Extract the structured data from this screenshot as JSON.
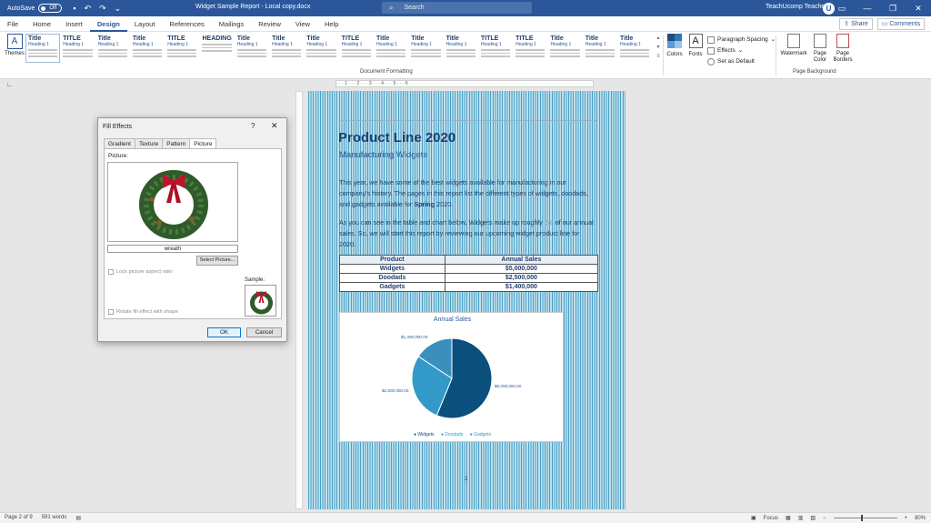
{
  "titlebar": {
    "autosave_label": "AutoSave",
    "autosave_state": "Off",
    "doc_title": "Widget Sample Report - Local copy.docx",
    "search_placeholder": "Search",
    "user_name": "TeachUcomp Teacher",
    "avatar_initial": "U"
  },
  "tabs": [
    "File",
    "Home",
    "Insert",
    "Design",
    "Layout",
    "References",
    "Mailings",
    "Review",
    "View",
    "Help"
  ],
  "active_tab": "Design",
  "share_label": "Share",
  "comments_label": "Comments",
  "ribbon": {
    "themes_label": "Themes",
    "style_titles": [
      "Title",
      "TITLE",
      "Title",
      "Title",
      "TITLE",
      "HEADING 1",
      "Title",
      "Title",
      "Title",
      "TITLE",
      "Title",
      "Title",
      "Title",
      "TITLE",
      "TITLE",
      "Title",
      "Title",
      "Title"
    ],
    "style_headings": [
      "Heading 1",
      "Heading 1",
      "Heading 1",
      "Heading 1",
      "Heading 1",
      "",
      "Heading 1",
      "Heading 1",
      "Heading 1",
      "Heading 1",
      "Heading 1",
      "Heading 1",
      "Heading 1",
      "Heading 1",
      "Heading 1",
      "Heading 1",
      "Heading 1",
      "Heading 1"
    ],
    "doc_formatting_label": "Document Formatting",
    "colors_label": "Colors",
    "fonts_label": "Fonts",
    "paragraph_spacing_label": "Paragraph Spacing",
    "effects_label": "Effects",
    "set_default_label": "Set as Default",
    "watermark_label": "Watermark",
    "page_color_label": "Page Color",
    "page_borders_label": "Page Borders",
    "page_background_label": "Page Background",
    "accent_colors": [
      "#1f4e79",
      "#2e75b6",
      "#5b9bd5",
      "#9dc3e6"
    ]
  },
  "document": {
    "heading": "Product Line 2020",
    "subheading": "Manufacturing Widgets",
    "para1_a": "This year, we have some of the best widgets available for manufacturing in our company's history. The pages in this report list the different types of widgets, doodads, and gadgets available for ",
    "para1_b": "Spring",
    "para1_c": " 2020.",
    "para2_a": "As you can see in the table and chart below, Widgets make up roughly ",
    "para2_b": "5/8",
    "para2_c": " of our annual sales. So, we will start this report by reviewing our upcoming widget product line for 2020.",
    "table_headers": [
      "Product",
      "Annual Sales"
    ],
    "table_rows": [
      [
        "Widgets",
        "$5,000,000"
      ],
      [
        "Doodads",
        "$2,500,000"
      ],
      [
        "Gadgets",
        "$1,400,000"
      ]
    ],
    "page_number": "2"
  },
  "chart_data": {
    "type": "pie",
    "title": "Annual Sales",
    "categories": [
      "Widgets",
      "Doodads",
      "Gadgets"
    ],
    "values": [
      5000000,
      2500000,
      1400000
    ],
    "value_labels": [
      "$5,000,000.00",
      "$2,500,000.00",
      "$1,400,000.00"
    ],
    "colors": [
      "#0b4f7c",
      "#3399c8",
      "#3a8fbd"
    ],
    "legend_position": "bottom"
  },
  "dialog": {
    "title": "Fill Effects",
    "help": "?",
    "close": "✕",
    "tabs": [
      "Gradient",
      "Texture",
      "Pattern",
      "Picture"
    ],
    "active_tab": "Picture",
    "picture_label": "Picture:",
    "picture_name": "wreath",
    "select_picture_label": "Select Picture...",
    "lock_aspect_label": "Lock picture aspect ratio",
    "sample_label": "Sample:",
    "rotate_label": "Rotate fill effect with shape",
    "ok_label": "OK",
    "cancel_label": "Cancel"
  },
  "statusbar": {
    "page_info": "Page 2 of 9",
    "word_count": "591 words",
    "focus_label": "Focus",
    "zoom": "80%"
  }
}
